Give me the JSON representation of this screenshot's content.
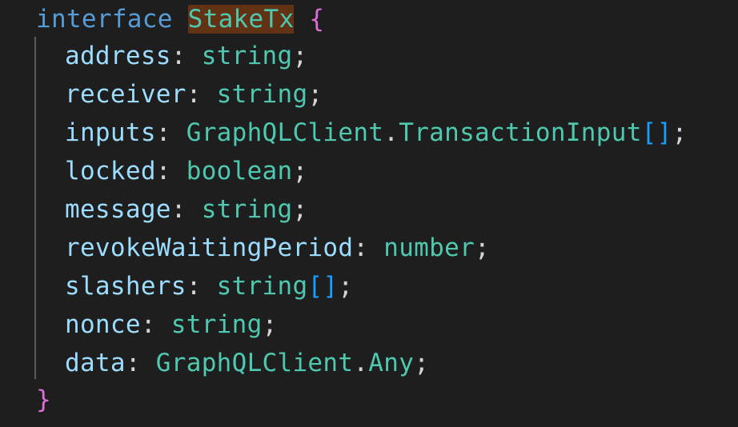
{
  "code": {
    "keyword": "interface",
    "interface_name": "StakeTx",
    "open_brace": "{",
    "close_brace": "}",
    "colon": ":",
    "semicolon": ";",
    "dot": ".",
    "array_brackets": "[]",
    "namespace": "GraphQLClient",
    "fields": [
      {
        "name": "address",
        "type": "string"
      },
      {
        "name": "receiver",
        "type": "string"
      },
      {
        "name": "inputs",
        "type": "TransactionInput"
      },
      {
        "name": "locked",
        "type": "boolean"
      },
      {
        "name": "message",
        "type": "string"
      },
      {
        "name": "revokeWaitingPeriod",
        "type": "number"
      },
      {
        "name": "slashers",
        "type": "string"
      },
      {
        "name": "nonce",
        "type": "string"
      },
      {
        "name": "data",
        "type": "Any"
      }
    ]
  },
  "colors": {
    "background": "#1e1e1e",
    "keyword": "#569cd6",
    "type": "#4ec9b0",
    "property": "#9cdcfe",
    "brace": "#da70d6",
    "bracket": "#179fff",
    "punctuation": "#d4d4d4",
    "highlight": "#613214"
  }
}
